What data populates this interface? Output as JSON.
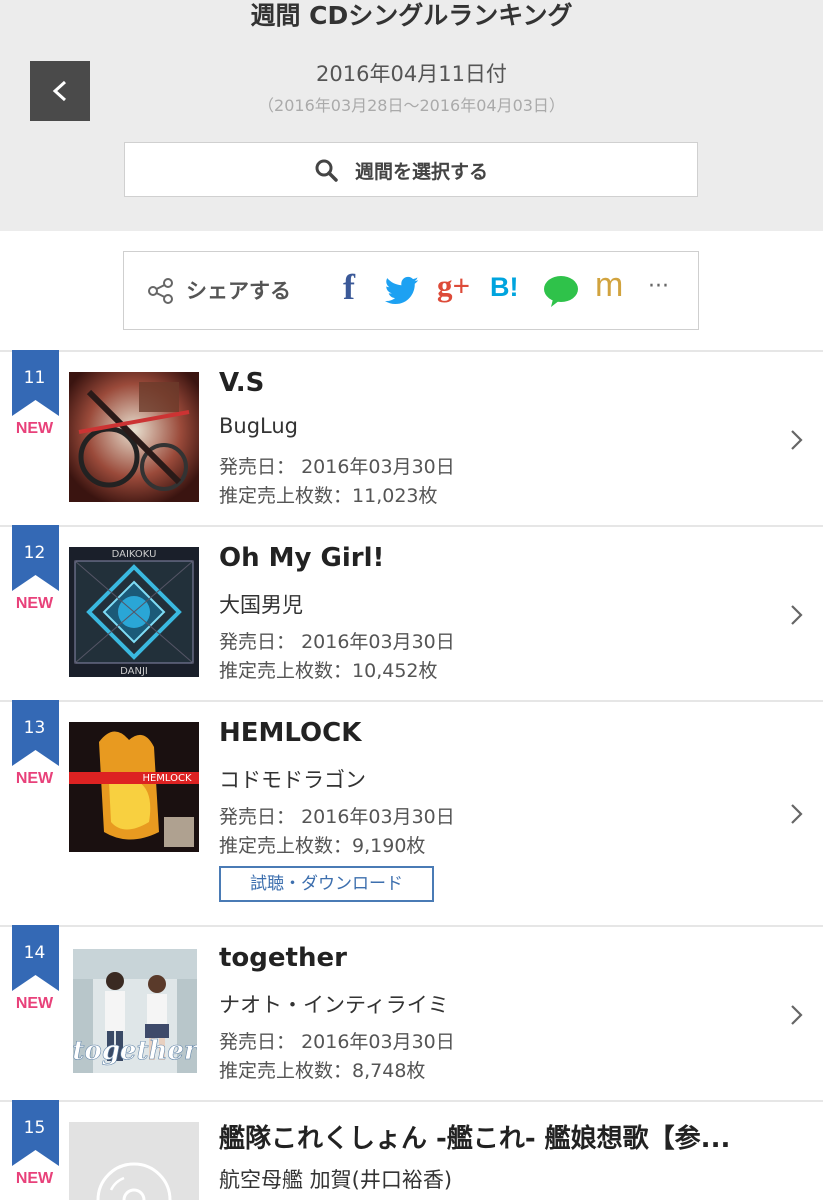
{
  "header": {
    "title": "週間 CDシングルランキング",
    "date": "2016年04月11日付",
    "range": "（2016年03月28日〜2016年04月03日）",
    "select_label": "週間を選択する"
  },
  "share": {
    "label": "シェアする",
    "services": [
      {
        "name": "facebook",
        "glyph": "f",
        "color": "#3b5998"
      },
      {
        "name": "twitter",
        "glyph": "",
        "color": "#1da1f2"
      },
      {
        "name": "google-plus",
        "glyph": "g+",
        "color": "#dd4b39"
      },
      {
        "name": "hatena",
        "glyph": "B!",
        "color": "#00a4de"
      },
      {
        "name": "line",
        "glyph": "",
        "color": "#2fc24a"
      },
      {
        "name": "mixi",
        "glyph": "m",
        "color": "#d1a33e"
      },
      {
        "name": "more",
        "glyph": "···",
        "color": "#666"
      }
    ]
  },
  "colors": {
    "rank_flag": "#3469b5",
    "new": "#e8417a",
    "button_border": "#4a7bb5"
  },
  "rankings": [
    {
      "rank": "11",
      "badge": "NEW",
      "title": "V.S",
      "artist": "BugLug",
      "release_label": "発売日：",
      "release_date": "2016年03月30日",
      "sales_label": "推定売上枚数：",
      "sales": "11,023枚"
    },
    {
      "rank": "12",
      "badge": "NEW",
      "title": "Oh My Girl!",
      "artist": "大国男児",
      "release_label": "発売日：",
      "release_date": "2016年03月30日",
      "sales_label": "推定売上枚数：",
      "sales": "10,452枚",
      "jacket_text_top": "DAIKOKU",
      "jacket_text_bottom": "DANJI"
    },
    {
      "rank": "13",
      "badge": "NEW",
      "title": "HEMLOCK",
      "artist": "コドモドラゴン",
      "release_label": "発売日：",
      "release_date": "2016年03月30日",
      "sales_label": "推定売上枚数：",
      "sales": "9,190枚",
      "button": "試聴・ダウンロード",
      "jacket_text": "HEMLOCK"
    },
    {
      "rank": "14",
      "badge": "NEW",
      "title": "together",
      "artist": "ナオト・インティライミ",
      "release_label": "発売日：",
      "release_date": "2016年03月30日",
      "sales_label": "推定売上枚数：",
      "sales": "8,748枚",
      "jacket_text": "together"
    },
    {
      "rank": "15",
      "badge": "NEW",
      "title": "艦隊これくしょん -艦これ- 艦娘想歌【参...",
      "artist": "航空母艦 加賀(井口裕香)"
    }
  ]
}
